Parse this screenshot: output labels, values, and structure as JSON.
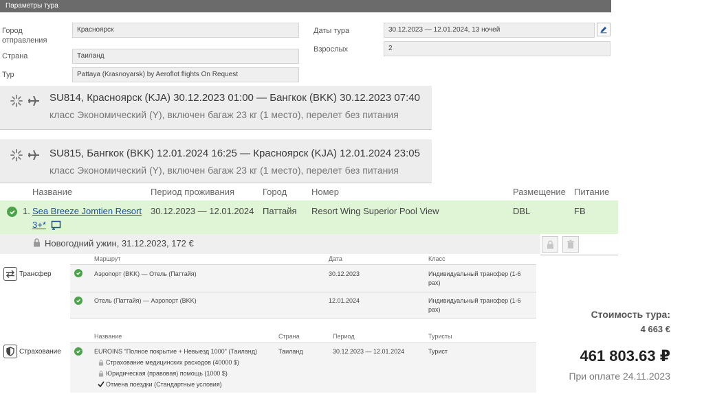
{
  "header": {
    "title": "Параметры тура"
  },
  "params": {
    "city_label": "Город отправления",
    "city_value": "Красноярск",
    "country_label": "Страна",
    "country_value": "Таиланд",
    "tour_label": "Тур",
    "tour_value": "Pattaya (Krasnoyarsk) by Aeroflot flights On Request",
    "dates_label": "Даты тура",
    "dates_value": "30.12.2023 — 12.01.2024, 13  ночей",
    "adults_label": "Взрослых",
    "adults_value": "2"
  },
  "flights": [
    {
      "route": "SU814, Красноярск (KJA) 30.12.2023 01:00 — Бангкок (BKK) 30.12.2023 07:40",
      "details": "класс Экономический (Y), включен багаж 23 кг (1 место), перелет без питания"
    },
    {
      "route": "SU815, Бангкок (BKK) 12.01.2024 16:25 — Красноярск (KJA) 12.01.2024 23:05",
      "details": "класс Экономический (Y), включен багаж 23 кг (1 место), перелет без питания"
    }
  ],
  "hotels": {
    "headers": [
      "Название",
      "Период проживания",
      "Город",
      "Номер",
      "Размещение",
      "Питание"
    ],
    "row": {
      "index": "1.",
      "name_line1": "Sea Breeze Jomtien Resort",
      "name_line2": "3+*",
      "period": "30.12.2023 — 12.01.2024",
      "city": "Паттайя",
      "room": "Resort Wing Superior Pool View",
      "accommodation": "DBL",
      "meal": "FB"
    },
    "extra": "Новогодний ужин, 31.12.2023, 172 €"
  },
  "transfer": {
    "section_label": "Трансфер",
    "headers": [
      "Маршрут",
      "Дата",
      "Класс"
    ],
    "rows": [
      {
        "route": "Аэропорт (BKK) — Отель (Паттайя)",
        "date": "30.12.2023",
        "class": "Индивидуальный трансфер (1-6 pax)"
      },
      {
        "route": "Отель (Паттайя) — Аэропорт (BKK)",
        "date": "12.01.2024",
        "class": "Индивидуальный трансфер (1-6 pax)"
      }
    ]
  },
  "insurance": {
    "section_label": "Страхование",
    "headers": [
      "Название",
      "Страна",
      "Период",
      "Туристы"
    ],
    "row": {
      "name": "EUROINS \"Полное покрытие + Невыезд 1000\" (Таиланд)",
      "country": "Таиланд",
      "period": "30.12.2023 — 12.01.2024",
      "tourists": "Турист",
      "items": [
        "Страхование медицинских расходов (40000 $)",
        "Юридическая (правовая) помощь (1000 $)",
        "Отмена поездки (Стандартные условия)"
      ]
    }
  },
  "price": {
    "label": "Стоимость тура:",
    "eur": "4 663 €",
    "rub": "461 803.63 ₽",
    "payment": "При оплате 24.11.2023"
  },
  "colors": {
    "header_bg": "#6b6b6b",
    "ok_green": "#4ca34c",
    "hotel_row_bg": "#dff5d5",
    "link": "#1a4f9c"
  }
}
